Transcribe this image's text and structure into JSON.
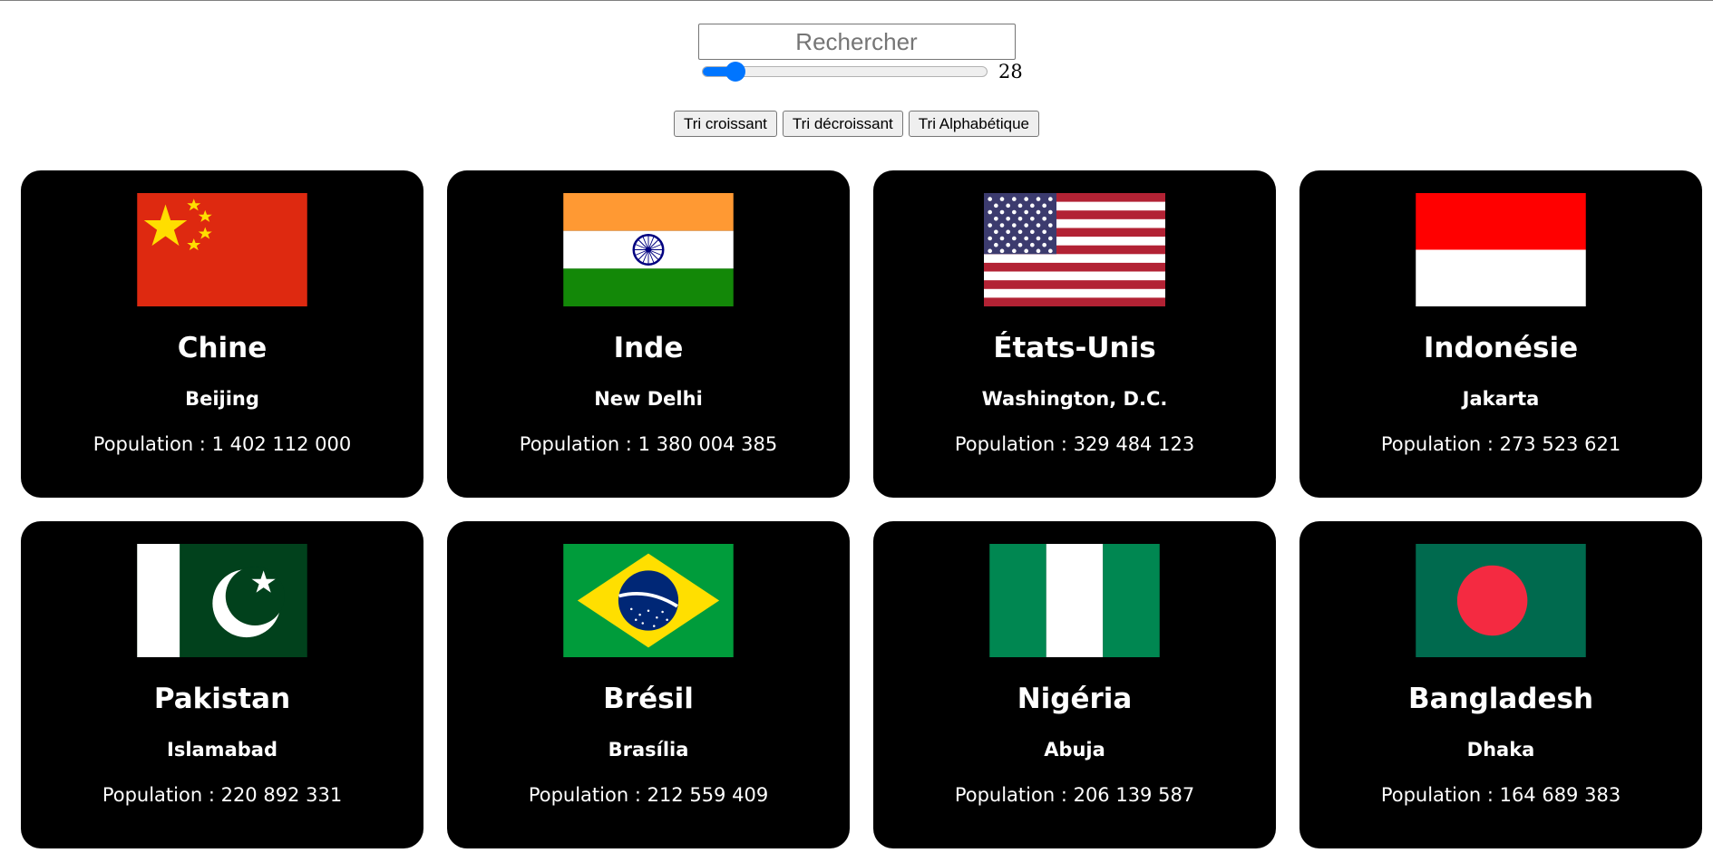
{
  "search": {
    "placeholder": "Rechercher"
  },
  "slider": {
    "value": "28",
    "fraction": 0.115
  },
  "buttons": {
    "asc": "Tri croissant",
    "desc": "Tri décroissant",
    "alpha": "Tri Alphabétique"
  },
  "population_prefix": "Population : ",
  "countries": [
    {
      "name": "Chine",
      "capital": "Beijing",
      "population": "1 402 112 000",
      "flag": "china-flag-icon"
    },
    {
      "name": "Inde",
      "capital": "New Delhi",
      "population": "1 380 004 385",
      "flag": "india-flag-icon"
    },
    {
      "name": "États-Unis",
      "capital": "Washington, D.C.",
      "population": "329 484 123",
      "flag": "usa-flag-icon"
    },
    {
      "name": "Indonésie",
      "capital": "Jakarta",
      "population": "273 523 621",
      "flag": "indonesia-flag-icon"
    },
    {
      "name": "Pakistan",
      "capital": "Islamabad",
      "population": "220 892 331",
      "flag": "pakistan-flag-icon"
    },
    {
      "name": "Brésil",
      "capital": "Brasília",
      "population": "212 559 409",
      "flag": "brazil-flag-icon"
    },
    {
      "name": "Nigéria",
      "capital": "Abuja",
      "population": "206 139 587",
      "flag": "nigeria-flag-icon"
    },
    {
      "name": "Bangladesh",
      "capital": "Dhaka",
      "population": "164 689 383",
      "flag": "bangladesh-flag-icon"
    }
  ],
  "colors": {
    "card_bg": "#000000",
    "accent": "#0075ff"
  }
}
